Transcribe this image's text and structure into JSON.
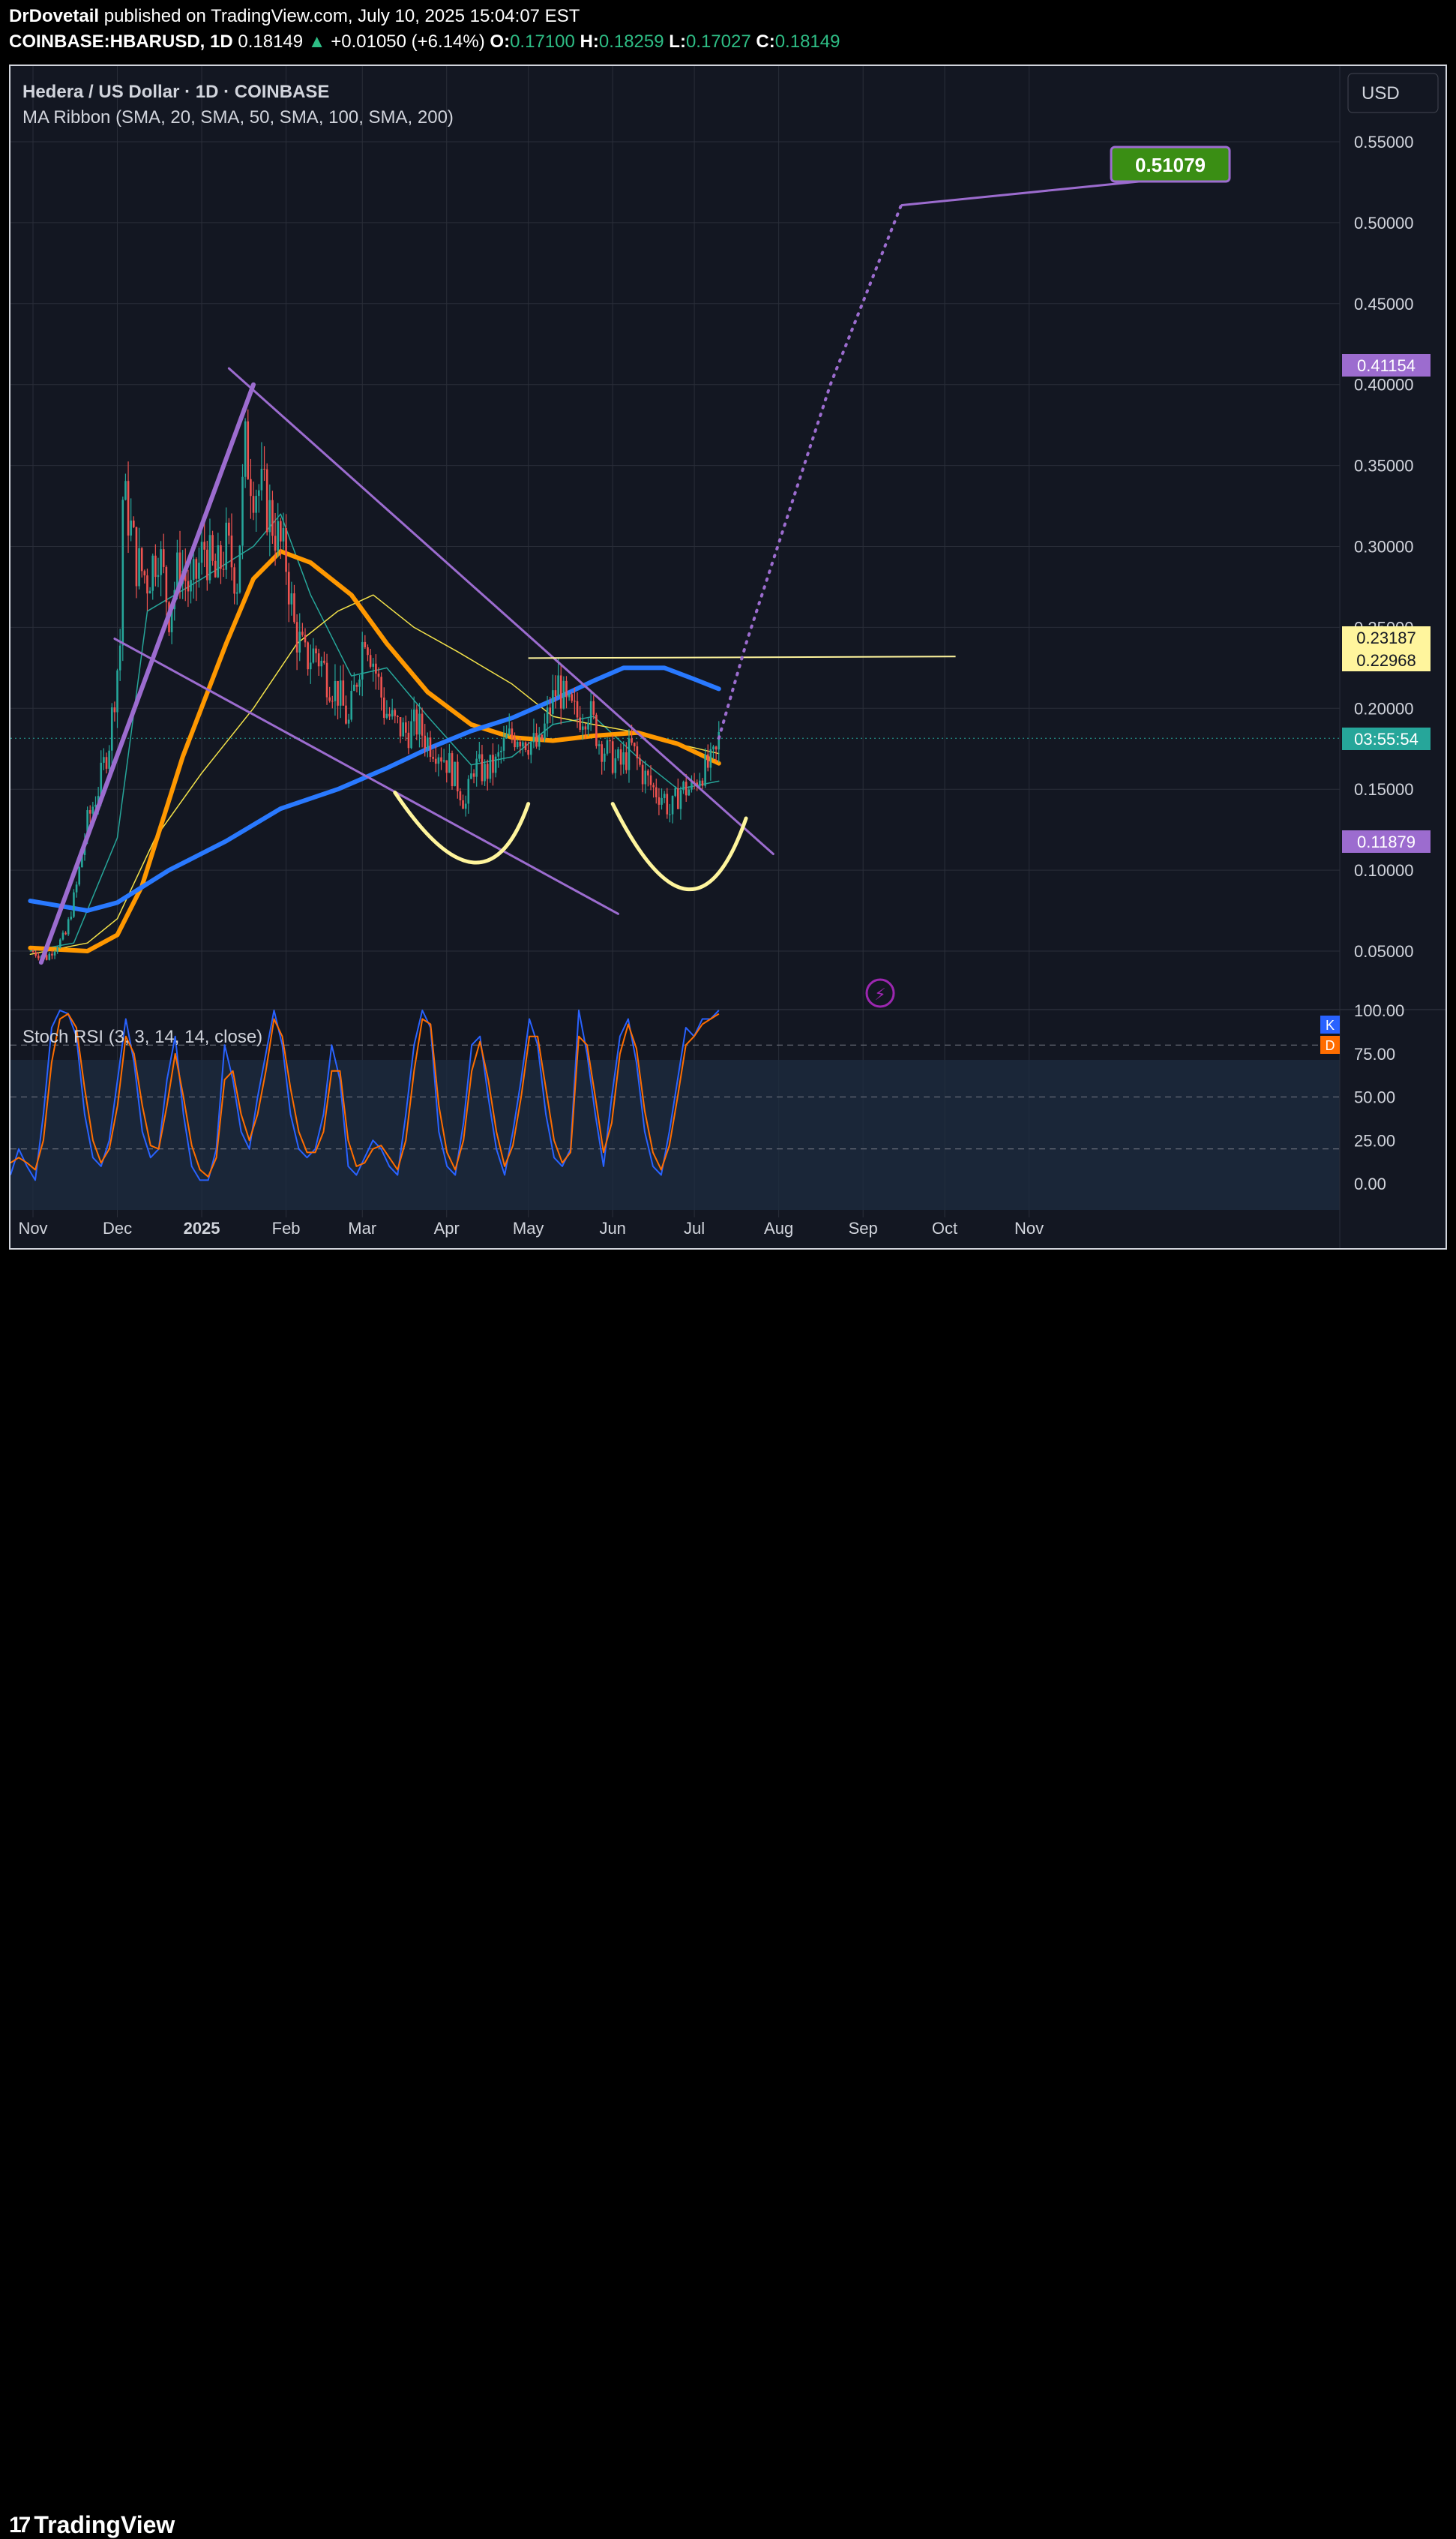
{
  "header": {
    "author": "DrDovetail",
    "published_text": "published on TradingView.com, July 10, 2025 15:04:07 EST",
    "symbol": "COINBASE:HBARUSD, 1D",
    "last": "0.18149",
    "up_arrow": "▲",
    "change": "+0.01050 (+6.14%)",
    "o_label": "O:",
    "o": "0.17100",
    "h_label": "H:",
    "h": "0.18259",
    "l_label": "L:",
    "l": "0.17027",
    "c_label": "C:",
    "c": "0.18149"
  },
  "legend": {
    "title": "Hedera / US Dollar · 1D · COINBASE",
    "indicator": "MA Ribbon (SMA, 20, SMA, 50, SMA, 100, SMA, 200)",
    "stoch": "Stoch RSI (3, 3, 14, 14, close)",
    "currency_button": "USD",
    "k_badge": "K",
    "d_badge": "D",
    "alert_icon": "⚡"
  },
  "badges": {
    "target": "0.51079",
    "upper": "0.41154",
    "neck_a": "0.23187",
    "neck_b": "0.22968",
    "countdown": "03:55:54",
    "lower": "0.11879"
  },
  "colors": {
    "up": "#26a69a",
    "down": "#ef5350",
    "ma20": "#26a69a",
    "ma50": "#f4e34a",
    "ma100": "#ff9800",
    "ma200": "#2979ff",
    "trend": "#9c6ccf",
    "arc": "#fff59d",
    "k": "#2962ff",
    "d": "#ff6d00",
    "target_bg": "#3a8e14"
  },
  "footer": {
    "brand": "TradingView",
    "brand_mark": "17"
  },
  "chart_data": [
    {
      "type": "candlestick",
      "title": "Hedera / US Dollar · 1D · COINBASE",
      "x_ticks": [
        "Nov",
        "Dec",
        "2025",
        "Feb",
        "Mar",
        "Apr",
        "May",
        "Jun",
        "Jul",
        "Aug",
        "Sep",
        "Oct",
        "Nov"
      ],
      "y_ticks": [
        "0.05000",
        "0.10000",
        "0.15000",
        "0.20000",
        "0.25000",
        "0.30000",
        "0.35000",
        "0.40000",
        "0.45000",
        "0.50000",
        "0.55000"
      ],
      "ylim": [
        0.0,
        0.58
      ],
      "grid": true,
      "last_price": 0.18149,
      "close_path": [
        [
          "2024-10-30",
          0.05
        ],
        [
          "2024-11-05",
          0.046
        ],
        [
          "2024-11-08",
          0.052
        ],
        [
          "2024-11-12",
          0.06
        ],
        [
          "2024-11-16",
          0.09
        ],
        [
          "2024-11-20",
          0.13
        ],
        [
          "2024-11-24",
          0.15
        ],
        [
          "2024-11-28",
          0.18
        ],
        [
          "2024-12-02",
          0.24
        ],
        [
          "2024-12-03",
          0.33
        ],
        [
          "2024-12-05",
          0.32
        ],
        [
          "2024-12-08",
          0.29
        ],
        [
          "2024-12-12",
          0.28
        ],
        [
          "2024-12-16",
          0.3
        ],
        [
          "2024-12-20",
          0.26
        ],
        [
          "2024-12-24",
          0.29
        ],
        [
          "2024-12-28",
          0.27
        ],
        [
          "2025-01-02",
          0.3
        ],
        [
          "2025-01-06",
          0.28
        ],
        [
          "2025-01-10",
          0.3
        ],
        [
          "2025-01-14",
          0.28
        ],
        [
          "2025-01-17",
          0.36
        ],
        [
          "2025-01-20",
          0.34
        ],
        [
          "2025-01-24",
          0.33
        ],
        [
          "2025-01-28",
          0.31
        ],
        [
          "2025-02-01",
          0.29
        ],
        [
          "2025-02-04",
          0.25
        ],
        [
          "2025-02-08",
          0.23
        ],
        [
          "2025-02-12",
          0.235
        ],
        [
          "2025-02-16",
          0.22
        ],
        [
          "2025-02-20",
          0.21
        ],
        [
          "2025-02-24",
          0.19
        ],
        [
          "2025-03-02",
          0.25
        ],
        [
          "2025-03-05",
          0.23
        ],
        [
          "2025-03-09",
          0.2
        ],
        [
          "2025-03-13",
          0.19
        ],
        [
          "2025-03-17",
          0.185
        ],
        [
          "2025-03-21",
          0.19
        ],
        [
          "2025-03-25",
          0.18
        ],
        [
          "2025-03-29",
          0.175
        ],
        [
          "2025-04-02",
          0.165
        ],
        [
          "2025-04-06",
          0.15
        ],
        [
          "2025-04-08",
          0.14
        ],
        [
          "2025-04-11",
          0.165
        ],
        [
          "2025-04-15",
          0.16
        ],
        [
          "2025-04-19",
          0.165
        ],
        [
          "2025-04-23",
          0.18
        ],
        [
          "2025-04-27",
          0.185
        ],
        [
          "2025-05-01",
          0.18
        ],
        [
          "2025-05-05",
          0.175
        ],
        [
          "2025-05-09",
          0.2
        ],
        [
          "2025-05-12",
          0.215
        ],
        [
          "2025-05-15",
          0.2
        ],
        [
          "2025-05-19",
          0.195
        ],
        [
          "2025-05-23",
          0.2
        ],
        [
          "2025-05-27",
          0.18
        ],
        [
          "2025-05-31",
          0.17
        ],
        [
          "2025-06-04",
          0.165
        ],
        [
          "2025-06-08",
          0.175
        ],
        [
          "2025-06-12",
          0.16
        ],
        [
          "2025-06-16",
          0.15
        ],
        [
          "2025-06-20",
          0.145
        ],
        [
          "2025-06-22",
          0.135
        ],
        [
          "2025-06-26",
          0.15
        ],
        [
          "2025-06-30",
          0.15
        ],
        [
          "2025-07-03",
          0.16
        ],
        [
          "2025-07-07",
          0.165
        ],
        [
          "2025-07-09",
          0.171
        ],
        [
          "2025-07-10",
          0.18149
        ]
      ],
      "moving_averages": [
        {
          "name": "SMA 20",
          "color": "#26a69a",
          "points": [
            [
              "2024-10-30",
              0.05
            ],
            [
              "2024-11-15",
              0.055
            ],
            [
              "2024-12-01",
              0.12
            ],
            [
              "2024-12-12",
              0.26
            ],
            [
              "2025-01-01",
              0.28
            ],
            [
              "2025-01-20",
              0.3
            ],
            [
              "2025-01-30",
              0.32
            ],
            [
              "2025-02-10",
              0.27
            ],
            [
              "2025-02-25",
              0.22
            ],
            [
              "2025-03-10",
              0.225
            ],
            [
              "2025-03-25",
              0.195
            ],
            [
              "2025-04-10",
              0.165
            ],
            [
              "2025-04-25",
              0.17
            ],
            [
              "2025-05-10",
              0.19
            ],
            [
              "2025-05-25",
              0.195
            ],
            [
              "2025-06-10",
              0.17
            ],
            [
              "2025-06-25",
              0.15
            ],
            [
              "2025-07-10",
              0.155
            ]
          ]
        },
        {
          "name": "SMA 50",
          "color": "#f4e34a",
          "points": [
            [
              "2024-10-30",
              0.048
            ],
            [
              "2024-11-20",
              0.055
            ],
            [
              "2024-12-01",
              0.07
            ],
            [
              "2024-12-15",
              0.12
            ],
            [
              "2025-01-01",
              0.16
            ],
            [
              "2025-01-20",
              0.2
            ],
            [
              "2025-02-05",
              0.24
            ],
            [
              "2025-02-20",
              0.26
            ],
            [
              "2025-03-05",
              0.27
            ],
            [
              "2025-03-20",
              0.25
            ],
            [
              "2025-04-05",
              0.235
            ],
            [
              "2025-04-25",
              0.215
            ],
            [
              "2025-05-10",
              0.195
            ],
            [
              "2025-05-25",
              0.19
            ],
            [
              "2025-06-10",
              0.185
            ],
            [
              "2025-06-25",
              0.178
            ],
            [
              "2025-07-10",
              0.172
            ]
          ]
        },
        {
          "name": "SMA 100",
          "color": "#ff9800",
          "points": [
            [
              "2024-10-30",
              0.052
            ],
            [
              "2024-11-20",
              0.05
            ],
            [
              "2024-12-01",
              0.06
            ],
            [
              "2024-12-10",
              0.09
            ],
            [
              "2024-12-25",
              0.17
            ],
            [
              "2025-01-10",
              0.24
            ],
            [
              "2025-01-20",
              0.28
            ],
            [
              "2025-01-30",
              0.297
            ],
            [
              "2025-02-10",
              0.29
            ],
            [
              "2025-02-25",
              0.27
            ],
            [
              "2025-03-10",
              0.24
            ],
            [
              "2025-03-25",
              0.21
            ],
            [
              "2025-04-10",
              0.19
            ],
            [
              "2025-04-25",
              0.182
            ],
            [
              "2025-05-10",
              0.18
            ],
            [
              "2025-05-25",
              0.183
            ],
            [
              "2025-06-10",
              0.185
            ],
            [
              "2025-06-25",
              0.178
            ],
            [
              "2025-07-10",
              0.166
            ]
          ]
        },
        {
          "name": "SMA 200",
          "color": "#2979ff",
          "points": [
            [
              "2024-10-30",
              0.081
            ],
            [
              "2024-11-20",
              0.075
            ],
            [
              "2024-12-01",
              0.08
            ],
            [
              "2024-12-20",
              0.1
            ],
            [
              "2025-01-10",
              0.118
            ],
            [
              "2025-01-30",
              0.138
            ],
            [
              "2025-02-20",
              0.15
            ],
            [
              "2025-03-10",
              0.163
            ],
            [
              "2025-03-25",
              0.175
            ],
            [
              "2025-04-10",
              0.186
            ],
            [
              "2025-04-25",
              0.194
            ],
            [
              "2025-05-10",
              0.205
            ],
            [
              "2025-05-25",
              0.217
            ],
            [
              "2025-06-05",
              0.225
            ],
            [
              "2025-06-20",
              0.225
            ],
            [
              "2025-07-01",
              0.218
            ],
            [
              "2025-07-10",
              0.212
            ]
          ]
        }
      ],
      "annotations": {
        "target_label": "0.51079",
        "projection_path": [
          [
            "2025-07-10",
            0.18149
          ],
          [
            "2025-07-20",
            0.24
          ],
          [
            "2025-08-20",
            0.4
          ],
          [
            "2025-09-15",
            0.51079
          ]
        ],
        "neckline": [
          [
            "2025-05-01",
            0.231
          ],
          [
            "2025-10-05",
            0.232
          ]
        ],
        "trend_lines": [
          [
            [
              "2024-11-03",
              0.043
            ],
            [
              "2025-01-20",
              0.4
            ]
          ],
          [
            [
              "2025-01-11",
              0.41
            ],
            [
              "2025-07-30",
              0.11
            ]
          ],
          [
            [
              "2024-11-30",
              0.243
            ],
            [
              "2025-06-03",
              0.073
            ]
          ]
        ],
        "arcs": [
          {
            "from": [
              "2025-03-13",
              0.148
            ],
            "control": [
              "2025-04-15",
              0.065
            ],
            "to": [
              "2025-05-01",
              0.141
            ]
          },
          {
            "from": [
              "2025-06-01",
              0.141
            ],
            "control": [
              "2025-07-01",
              0.04
            ],
            "to": [
              "2025-07-20",
              0.132
            ]
          }
        ]
      }
    },
    {
      "type": "line",
      "title": "Stoch RSI (3, 3, 14, 14, close)",
      "y_ticks": [
        "0.00",
        "25.00",
        "50.00",
        "75.00",
        "100.00"
      ],
      "ylim": [
        0,
        100
      ],
      "band": [
        20,
        80
      ],
      "series": [
        {
          "name": "K",
          "color": "#2962ff",
          "values": [
            5,
            20,
            10,
            2,
            40,
            90,
            100,
            98,
            85,
            40,
            15,
            10,
            25,
            60,
            95,
            70,
            30,
            15,
            20,
            60,
            85,
            40,
            10,
            2,
            2,
            20,
            80,
            60,
            30,
            20,
            50,
            75,
            100,
            80,
            40,
            20,
            15,
            20,
            40,
            80,
            60,
            10,
            5,
            15,
            25,
            20,
            10,
            5,
            40,
            80,
            100,
            90,
            30,
            10,
            5,
            35,
            80,
            85,
            50,
            20,
            5,
            30,
            60,
            95,
            80,
            40,
            15,
            10,
            20,
            100,
            75,
            40,
            10,
            50,
            85,
            95,
            70,
            30,
            10,
            5,
            30,
            60,
            90,
            85,
            95,
            95,
            100
          ]
        },
        {
          "name": "D",
          "color": "#ff6d00",
          "values": [
            12,
            15,
            12,
            8,
            25,
            70,
            95,
            98,
            90,
            55,
            25,
            12,
            20,
            45,
            85,
            75,
            45,
            22,
            20,
            45,
            75,
            50,
            22,
            8,
            4,
            15,
            60,
            65,
            40,
            25,
            40,
            65,
            95,
            85,
            55,
            30,
            18,
            18,
            30,
            65,
            65,
            25,
            10,
            12,
            20,
            22,
            15,
            8,
            25,
            65,
            95,
            92,
            45,
            18,
            8,
            25,
            65,
            82,
            60,
            30,
            10,
            22,
            50,
            85,
            85,
            55,
            25,
            12,
            18,
            85,
            80,
            50,
            18,
            35,
            75,
            92,
            78,
            42,
            18,
            8,
            22,
            50,
            80,
            85,
            92,
            95,
            98
          ]
        }
      ]
    }
  ]
}
